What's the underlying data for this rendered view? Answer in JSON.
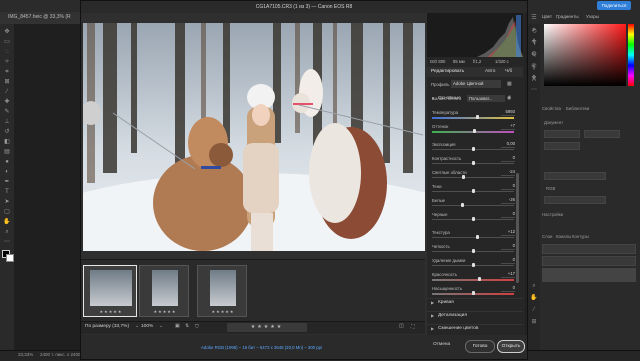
{
  "ps": {
    "doc_tab": "IMG_8457.heic @ 33,3% (R",
    "share_label": "Поделиться",
    "panel_tabs": [
      "Цвет",
      "Градиенты",
      "Узоры"
    ],
    "status_zoom": "33,33%",
    "status_info": "2400 т. пикс. х 2400 т.",
    "right_texts": [
      "Свойства",
      "Библиотеки",
      "Документ",
      "RGB",
      "Настройки",
      "Слои",
      "Каналы",
      "Контуры"
    ]
  },
  "cr": {
    "title": "CG1A7105.CR3 (1 из 3)  —  Canon EOS R8",
    "meta": {
      "iso": "ISO 800",
      "focal": "85 мм",
      "aperture": "f/1,2",
      "shutter": "1/320 с"
    },
    "edit": {
      "title": "Редактировать",
      "auto": "Авто",
      "bw": "Ч/б",
      "profile_label": "Профиль",
      "profile_value": "Adobe Цветной",
      "section_basic": "Основные",
      "sliders": [
        {
          "label": "Баланс белого",
          "value": "Пользоват...",
          "type": "select"
        },
        {
          "label": "Температура",
          "value": "5950",
          "pos": 0.56,
          "color": "temp"
        },
        {
          "label": "Оттенок",
          "value": "+7",
          "pos": 0.52,
          "color": "tint"
        },
        {
          "label": "Экспозиция",
          "value": "0,00",
          "pos": 0.5
        },
        {
          "label": "Контрастность",
          "value": "0",
          "pos": 0.5
        },
        {
          "label": "Светлые области",
          "value": "-24",
          "pos": 0.38
        },
        {
          "label": "Тени",
          "value": "0",
          "pos": 0.5
        },
        {
          "label": "Белые",
          "value": "-26",
          "pos": 0.37
        },
        {
          "label": "Черные",
          "value": "0",
          "pos": 0.5
        },
        {
          "label": "Текстура",
          "value": "+12",
          "pos": 0.56
        },
        {
          "label": "Четкость",
          "value": "0",
          "pos": 0.5
        },
        {
          "label": "Удаление дымки",
          "value": "0",
          "pos": 0.5
        },
        {
          "label": "Красочность",
          "value": "+17",
          "pos": 0.58,
          "color": "vib"
        },
        {
          "label": "Насыщенность",
          "value": "0",
          "pos": 0.5,
          "color": "sat"
        }
      ],
      "sections": [
        "Кривая",
        "Детализация",
        "Смешение цветов"
      ]
    },
    "filmstrip": {
      "stars": "★★★★★",
      "fit_label": "По размеру (33,7%)",
      "zoom_value": "100%",
      "rating": "★★★★★"
    },
    "footer": {
      "info": "Adobe RGB (1998) – 16 бит – 5472 x 3648 (20,0 Мп) – 300 ppi",
      "cancel": "Отмена",
      "done": "Готово",
      "open": "Открыть"
    }
  },
  "colors": {
    "accent": "#2f7fd8",
    "panel": "#262626",
    "dialog": "#2f2f2f"
  },
  "icons": [
    "move-icon",
    "lasso-icon",
    "brush-icon",
    "crop-icon",
    "eyedropper-icon",
    "text-icon",
    "zoom-icon",
    "hand-icon",
    "star-icon",
    "filter-icon",
    "gear-icon",
    "chevron-down-icon"
  ]
}
